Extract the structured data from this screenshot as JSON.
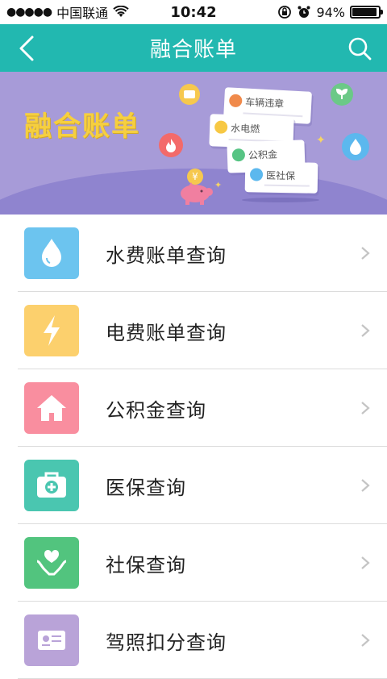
{
  "status_bar": {
    "signal": "●●●●●",
    "carrier": "中国联通",
    "time": "10:42",
    "battery_percent": "94%",
    "battery_level": 0.94
  },
  "nav": {
    "title": "融合账单",
    "color": "#22b8b0"
  },
  "banner": {
    "title": "融合账单",
    "cards": [
      "车辆违章",
      "水电燃",
      "公积金",
      "医社保"
    ],
    "coin_symbol": "¥"
  },
  "menu": {
    "items": [
      {
        "label": "水费账单查询",
        "icon": "water-drop-icon",
        "color": "#6cc4ef"
      },
      {
        "label": "电费账单查询",
        "icon": "lightning-icon",
        "color": "#fcd06d"
      },
      {
        "label": "公积金查询",
        "icon": "house-icon",
        "color": "#f98e9f"
      },
      {
        "label": "医保查询",
        "icon": "medical-kit-icon",
        "color": "#4ac6b0"
      },
      {
        "label": "社保查询",
        "icon": "heart-hands-icon",
        "color": "#52c47e"
      },
      {
        "label": "驾照扣分查询",
        "icon": "id-card-icon",
        "color": "#b9a3d8"
      }
    ]
  }
}
